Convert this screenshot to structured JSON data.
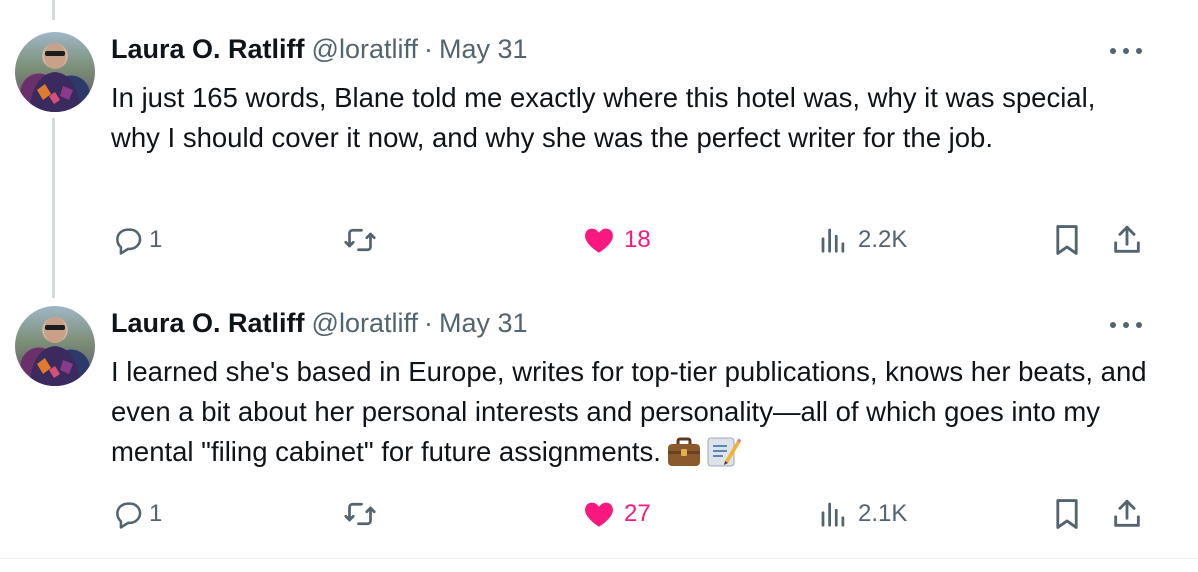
{
  "tweets": [
    {
      "author_name": "Laura O. Ratliff",
      "handle": "@loratliff",
      "separator": "·",
      "date": "May 31",
      "text": "In just 165 words, Blane told me exactly where this hotel was, why it was special, why I should cover it now, and why she was the perfect writer for the job.",
      "replies": "1",
      "likes": "18",
      "views": "2.2K"
    },
    {
      "author_name": "Laura O. Ratliff",
      "handle": "@loratliff",
      "separator": "·",
      "date": "May 31",
      "text": "I learned she's based in Europe, writes for top-tier publications, knows her beats, and even a bit about her personal interests and personality—all of which goes into my mental \"filing cabinet\" for future assignments.",
      "replies": "1",
      "likes": "27",
      "views": "2.1K"
    }
  ],
  "colors": {
    "text": "#0f1419",
    "secondary": "#536471",
    "like": "#f91880",
    "thread_line": "#cfd9de"
  },
  "icons": [
    "reply-icon",
    "retweet-icon",
    "heart-icon",
    "views-icon",
    "bookmark-icon",
    "share-icon",
    "more-icon",
    "briefcase-emoji",
    "memo-emoji"
  ]
}
